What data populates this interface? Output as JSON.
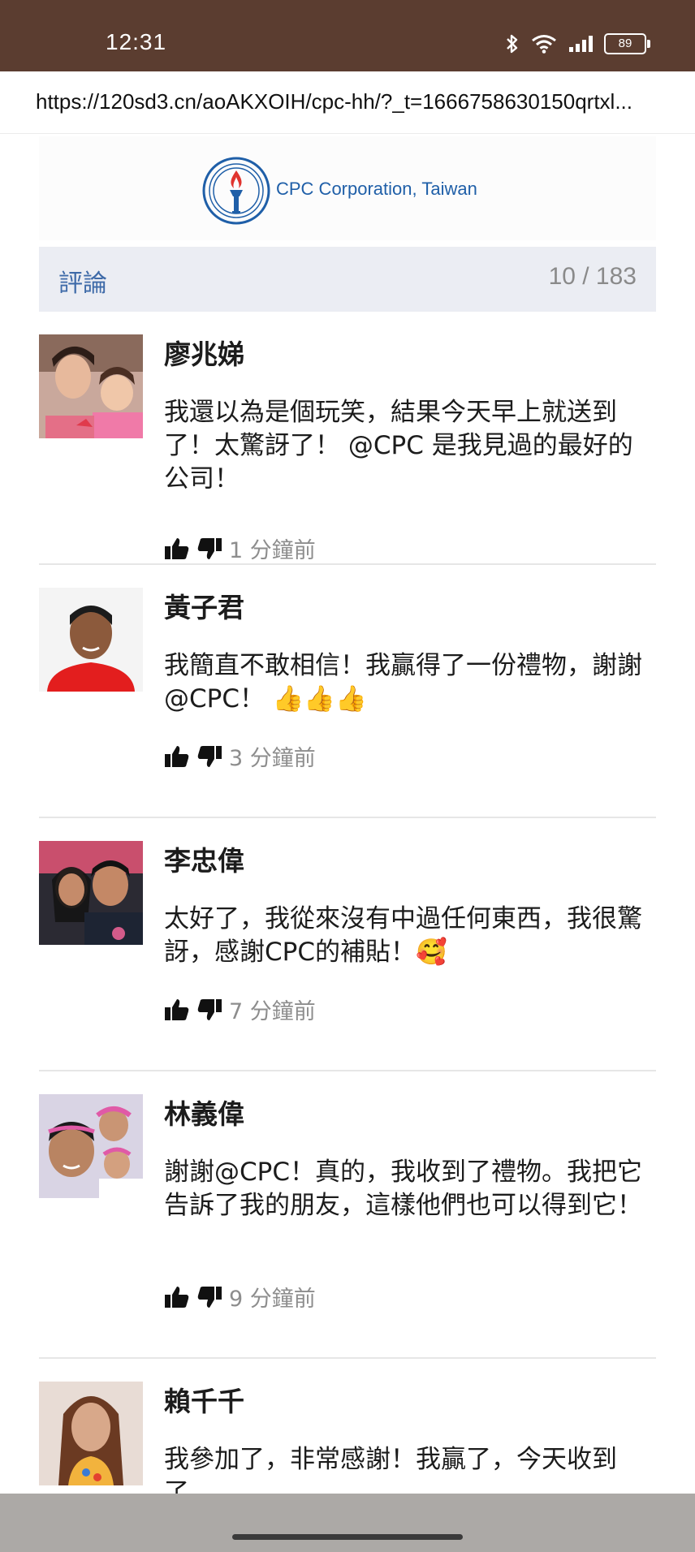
{
  "status_bar": {
    "time": "12:31",
    "battery": "89"
  },
  "browser": {
    "url": "https://120sd3.cn/aoAKXOIH/cpc-hh/?_t=1666758630150qrtxl..."
  },
  "brand": {
    "name": "CPC Corporation, Taiwan"
  },
  "comments_section": {
    "title": "評論",
    "count": "10 / 183"
  },
  "comments": [
    {
      "name": "廖兆娣",
      "text": "我還以為是個玩笑，結果今天早上就送到了！太驚訝了！ @CPC 是我見過的最好的公司！",
      "time": "1 分鐘前"
    },
    {
      "name": "黃子君",
      "text": "我簡直不敢相信！我贏得了一份禮物，謝謝@CPC！ 👍👍👍",
      "time": "3 分鐘前"
    },
    {
      "name": "李忠偉",
      "text": "太好了，我從來沒有中過任何東西，我很驚訝，感謝CPC的補貼！🥰",
      "time": "7 分鐘前"
    },
    {
      "name": "林義偉",
      "text": "謝謝@CPC！真的，我收到了禮物。我把它告訴了我的朋友，這樣他們也可以得到它！",
      "time": "9 分鐘前"
    },
    {
      "name": "賴千千",
      "text": "我參加了，非常感謝！我贏了，今天收到了。"
    }
  ],
  "colors": {
    "status_bar": "#5b3d30",
    "brand_blue": "#1f5fa8",
    "section_bg": "#ebedf3",
    "accent_title": "#3e6aa8"
  }
}
